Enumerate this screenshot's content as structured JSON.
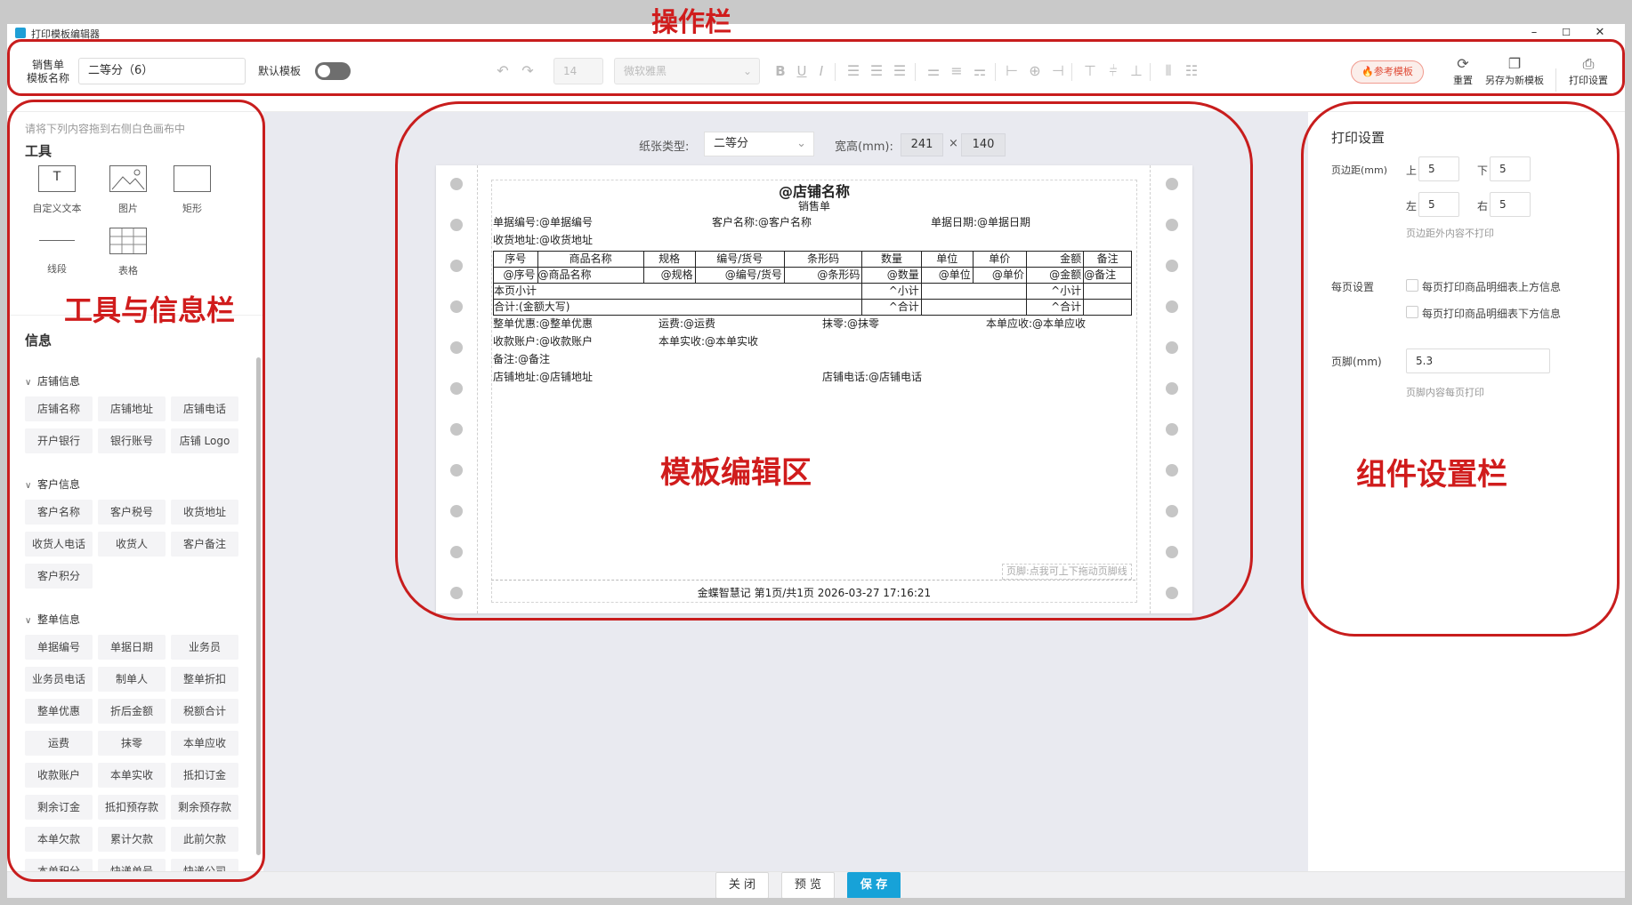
{
  "window": {
    "title": "打印模板编辑器",
    "minimize": "–",
    "maximize": "☐",
    "close": "✕"
  },
  "toolbar": {
    "label_line1": "销售单",
    "label_line2": "模板名称",
    "template_name": "二等分（6）",
    "default_label": "默认模板",
    "font_size": "14",
    "font_family": "微软雅黑",
    "bold": "B",
    "underline": "U",
    "italic": "I",
    "ref_button": "🔥参考模板",
    "reset": "重置",
    "save_as": "另存为新模板",
    "print_settings": "打印设置"
  },
  "left": {
    "hint": "请将下列内容拖到右侧白色画布中",
    "tools_title": "工具",
    "tools": [
      "自定义文本",
      "图片",
      "矩形",
      "线段",
      "表格"
    ],
    "text_tool_glyph": "T",
    "info_title": "信息",
    "groups": [
      {
        "name": "店铺信息",
        "items": [
          "店铺名称",
          "店铺地址",
          "店铺电话",
          "开户银行",
          "银行账号",
          "店铺 Logo"
        ]
      },
      {
        "name": "客户信息",
        "items": [
          "客户名称",
          "客户税号",
          "收货地址",
          "收货人电话",
          "收货人",
          "客户备注",
          "客户积分"
        ]
      },
      {
        "name": "整单信息",
        "items": [
          "单据编号",
          "单据日期",
          "业务员",
          "业务员电话",
          "制单人",
          "整单折扣",
          "整单优惠",
          "折后金额",
          "税额合计",
          "运费",
          "抹零",
          "本单应收",
          "收款账户",
          "本单实收",
          "抵扣订金",
          "剩余订金",
          "抵扣预存款",
          "剩余预存款",
          "本单欠款",
          "累计欠款",
          "此前欠款",
          "本单积分",
          "快递单号",
          "快递公司"
        ]
      }
    ]
  },
  "center": {
    "paper_type_label": "纸张类型:",
    "paper_type_value": "二等分",
    "size_label": "宽高(mm):",
    "width": "241",
    "times": "×",
    "height": "140",
    "doc": {
      "title": "@店铺名称",
      "subtitle": "销售单",
      "row1": [
        "单据编号:@单据编号",
        "客户名称:@客户名称",
        "单据日期:@单据日期"
      ],
      "row2": "收货地址:@收货地址",
      "table_header": [
        "序号",
        "商品名称",
        "规格",
        "编号/货号",
        "条形码",
        "数量",
        "单位",
        "单价",
        "金额",
        "备注"
      ],
      "table_row": [
        "@序号",
        "@商品名称",
        "@规格",
        "@编号/货号",
        "@条形码",
        "@数量",
        "@单位",
        "@单价",
        "@金额",
        "@备注"
      ],
      "subtotal": {
        "label": "本页小计",
        "qty": "^小计",
        "amount": "^小计"
      },
      "total": {
        "label": "合计:(金额大写)",
        "qty": "^合计",
        "amount": "^合计"
      },
      "info1": [
        "整单优惠:@整单优惠",
        "运费:@运费",
        "抹零:@抹零",
        "本单应收:@本单应收"
      ],
      "info2": [
        "收款账户:@收款账户",
        "本单实收:@本单实收"
      ],
      "info3": "备注:@备注",
      "info4": [
        "店铺地址:@店铺地址",
        "店铺电话:@店铺电话"
      ],
      "footer_hint": "页脚:点我可上下拖动页脚线",
      "footer": "金蝶智慧记   第1页/共1页   2026-03-27 17:16:21"
    }
  },
  "right": {
    "title": "打印设置",
    "margin_label": "页边距(mm)",
    "top_label": "上",
    "top": "5",
    "bottom_label": "下",
    "bottom": "5",
    "left_label": "左",
    "left": "5",
    "right_label": "右",
    "right": "5",
    "margin_note": "页边距外内容不打印",
    "page_settings_label": "每页设置",
    "opt_above": "每页打印商品明细表上方信息",
    "opt_below": "每页打印商品明细表下方信息",
    "footer_label": "页脚(mm)",
    "footer_value": "5.3",
    "footer_note": "页脚内容每页打印"
  },
  "bottom": {
    "close": "关 闭",
    "preview": "预 览",
    "save": "保 存"
  },
  "annotations": {
    "toolbar": "操作栏",
    "left": "工具与信息栏",
    "center": "模板编辑区",
    "right": "组件设置栏"
  },
  "colors": {
    "accent": "#17a2d8",
    "annotation": "#c81d1d"
  }
}
